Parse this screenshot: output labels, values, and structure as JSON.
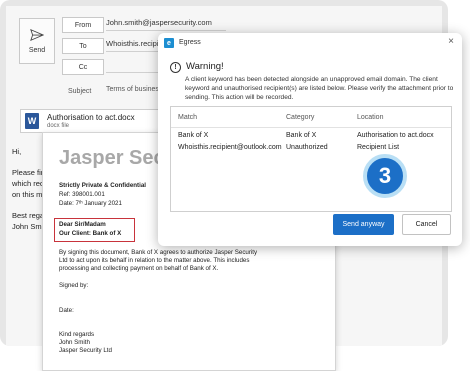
{
  "email": {
    "send_label": "Send",
    "from_label": "From",
    "from_value": "John.smith@jaspersecurity.com",
    "to_label": "To",
    "to_value": "Whoisthis.recipient@",
    "cc_label": "Cc",
    "subject_label": "Subject",
    "subject_value": "Terms of business",
    "attachment_name": "Authorisation to act.docx",
    "attachment_type": "docx file",
    "body_lines": [
      "Hi,",
      "Please fin",
      "which reci",
      "on this m",
      "Best rega",
      "John Smit"
    ]
  },
  "document": {
    "heading": "Jasper Secu",
    "lines": [
      "Strictly Private & Confidential",
      "Ref: 398001.001",
      "Date: 7ᵗʰ January 2021",
      "Dear Sir/Madam",
      "Our Client: Bank of X",
      "By signing this document, Bank of X agrees to authorize Jasper Security",
      "Ltd to act upon its behalf in relation to the matter above. This includes",
      "processing and collecting payment on behalf of Bank of X.",
      "Signed by:",
      "Date:",
      "Kind regards",
      "John Smith",
      "Jasper Security Ltd"
    ]
  },
  "dialog": {
    "app_name": "Egress",
    "close_glyph": "×",
    "warning_title": "Warning!",
    "warning_text": "A client keyword has been detected alongside an unapproved email domain. The client keyword and unauthorised recipient(s) are listed below. Please verify the attachment prior to sending. This action will be recorded.",
    "columns": [
      "Match",
      "Category",
      "Location"
    ],
    "rows": [
      [
        "Bank of X",
        "Bank of X",
        "Authorisation to act.docx"
      ],
      [
        "Whoisthis.recipient@outlook.com",
        "Unauthorized",
        "Recipient List"
      ]
    ],
    "step_number": "3",
    "send_anyway_label": "Send anyway",
    "cancel_label": "Cancel"
  },
  "colors": {
    "accent": "#1c6fc7",
    "badge_ring": "#b9dff5",
    "highlight_border": "#c8333b",
    "word_blue": "#2b579a"
  }
}
